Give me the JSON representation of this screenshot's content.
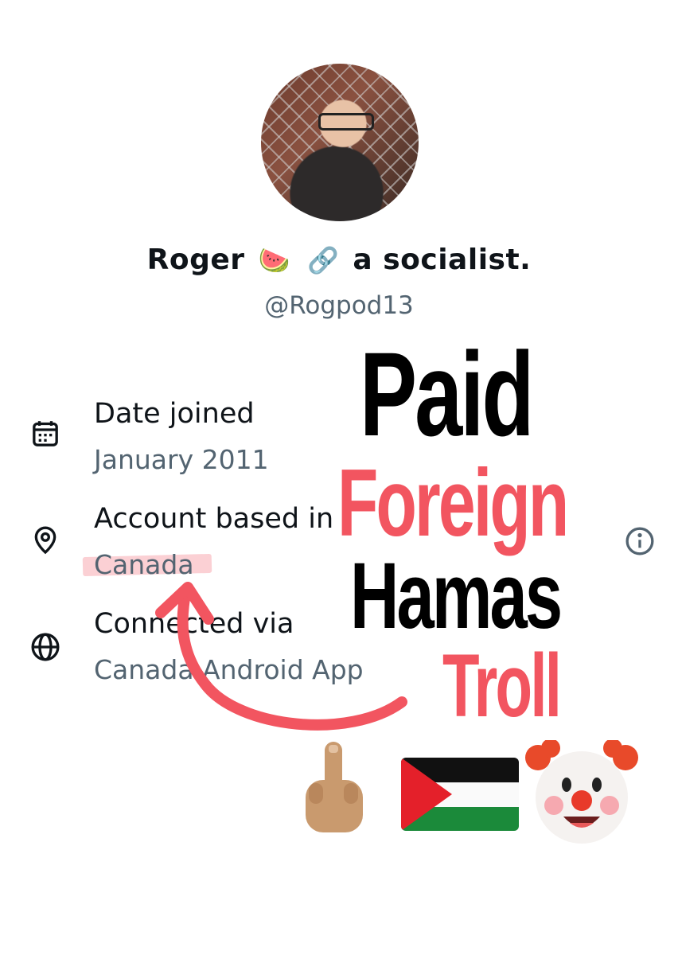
{
  "profile": {
    "display_name_pre": "Roger",
    "display_name_emoji_1": "🍉",
    "display_name_emoji_2": "🔗",
    "display_name_post": "a socialist.",
    "handle": "@Rogpod13"
  },
  "about": {
    "date_joined_label": "Date joined",
    "date_joined_value": "January 2011",
    "account_based_label": "Account based in",
    "account_based_value": "Canada",
    "connected_label": "Connected via",
    "connected_value": "Canada Android App"
  },
  "overlay": {
    "line1": "Paid",
    "line2": "Foreign",
    "line3": "Hamas",
    "line4": "Troll",
    "accent_color": "#f25560",
    "emojis": [
      "middle-finger-icon",
      "palestine-flag-icon",
      "clown-face-icon"
    ]
  },
  "icons": {
    "calendar": "calendar-icon",
    "location": "location-pin-icon",
    "globe": "globe-icon",
    "info": "info-icon"
  }
}
